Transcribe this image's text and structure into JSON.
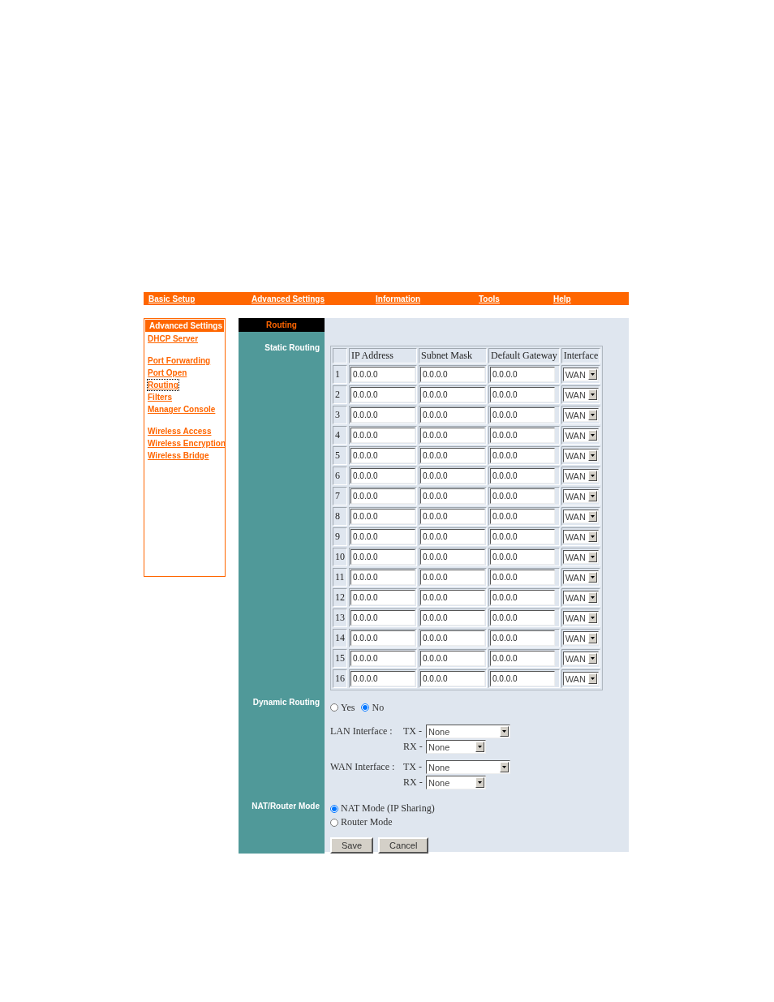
{
  "top_nav": [
    "Basic Setup",
    "Advanced Settings",
    "Information",
    "Tools",
    "Help"
  ],
  "sidebar": {
    "title": "Advanced Settings",
    "groups": [
      [
        {
          "label": "DHCP Server",
          "selected": false
        }
      ],
      [
        {
          "label": "Port Forwarding",
          "selected": false
        },
        {
          "label": "Port Open",
          "selected": false
        },
        {
          "label": "Routing",
          "selected": true
        },
        {
          "label": "Filters",
          "selected": false
        },
        {
          "label": "Manager Console",
          "selected": false
        }
      ],
      [
        {
          "label": "Wireless Access",
          "selected": false
        },
        {
          "label": "Wireless Encryption",
          "selected": false
        },
        {
          "label": "Wireless Bridge",
          "selected": false
        }
      ]
    ]
  },
  "page_title": "Routing",
  "static_routing": {
    "label": "Static Routing",
    "columns": [
      "IP Address",
      "Subnet Mask",
      "Default Gateway",
      "Interface"
    ],
    "rows": [
      {
        "number": "1",
        "ip_address": "0.0.0.0",
        "subnet_mask": "0.0.0.0",
        "default_gateway": "0.0.0.0",
        "interface": "WAN"
      },
      {
        "number": "2",
        "ip_address": "0.0.0.0",
        "subnet_mask": "0.0.0.0",
        "default_gateway": "0.0.0.0",
        "interface": "WAN"
      },
      {
        "number": "3",
        "ip_address": "0.0.0.0",
        "subnet_mask": "0.0.0.0",
        "default_gateway": "0.0.0.0",
        "interface": "WAN"
      },
      {
        "number": "4",
        "ip_address": "0.0.0.0",
        "subnet_mask": "0.0.0.0",
        "default_gateway": "0.0.0.0",
        "interface": "WAN"
      },
      {
        "number": "5",
        "ip_address": "0.0.0.0",
        "subnet_mask": "0.0.0.0",
        "default_gateway": "0.0.0.0",
        "interface": "WAN"
      },
      {
        "number": "6",
        "ip_address": "0.0.0.0",
        "subnet_mask": "0.0.0.0",
        "default_gateway": "0.0.0.0",
        "interface": "WAN"
      },
      {
        "number": "7",
        "ip_address": "0.0.0.0",
        "subnet_mask": "0.0.0.0",
        "default_gateway": "0.0.0.0",
        "interface": "WAN"
      },
      {
        "number": "8",
        "ip_address": "0.0.0.0",
        "subnet_mask": "0.0.0.0",
        "default_gateway": "0.0.0.0",
        "interface": "WAN"
      },
      {
        "number": "9",
        "ip_address": "0.0.0.0",
        "subnet_mask": "0.0.0.0",
        "default_gateway": "0.0.0.0",
        "interface": "WAN"
      },
      {
        "number": "10",
        "ip_address": "0.0.0.0",
        "subnet_mask": "0.0.0.0",
        "default_gateway": "0.0.0.0",
        "interface": "WAN"
      },
      {
        "number": "11",
        "ip_address": "0.0.0.0",
        "subnet_mask": "0.0.0.0",
        "default_gateway": "0.0.0.0",
        "interface": "WAN"
      },
      {
        "number": "12",
        "ip_address": "0.0.0.0",
        "subnet_mask": "0.0.0.0",
        "default_gateway": "0.0.0.0",
        "interface": "WAN"
      },
      {
        "number": "13",
        "ip_address": "0.0.0.0",
        "subnet_mask": "0.0.0.0",
        "default_gateway": "0.0.0.0",
        "interface": "WAN"
      },
      {
        "number": "14",
        "ip_address": "0.0.0.0",
        "subnet_mask": "0.0.0.0",
        "default_gateway": "0.0.0.0",
        "interface": "WAN"
      },
      {
        "number": "15",
        "ip_address": "0.0.0.0",
        "subnet_mask": "0.0.0.0",
        "default_gateway": "0.0.0.0",
        "interface": "WAN"
      },
      {
        "number": "16",
        "ip_address": "0.0.0.0",
        "subnet_mask": "0.0.0.0",
        "default_gateway": "0.0.0.0",
        "interface": "WAN"
      }
    ]
  },
  "dynamic_routing": {
    "label": "Dynamic Routing",
    "options": [
      {
        "label": "Yes",
        "selected": false
      },
      {
        "label": "No",
        "selected": true
      }
    ],
    "interfaces": [
      {
        "label": "LAN Interface :",
        "tx_label": "TX -",
        "tx": "None",
        "rx_label": "RX -",
        "rx": "None"
      },
      {
        "label": "WAN Interface :",
        "tx_label": "TX -",
        "tx": "None",
        "rx_label": "RX -",
        "rx": "None"
      }
    ]
  },
  "nat_router_mode": {
    "label": "NAT/Router Mode",
    "options": [
      {
        "label": "NAT Mode (IP Sharing)",
        "selected": true
      },
      {
        "label": "Router Mode",
        "selected": false
      }
    ]
  },
  "buttons": [
    "Save",
    "Cancel"
  ]
}
